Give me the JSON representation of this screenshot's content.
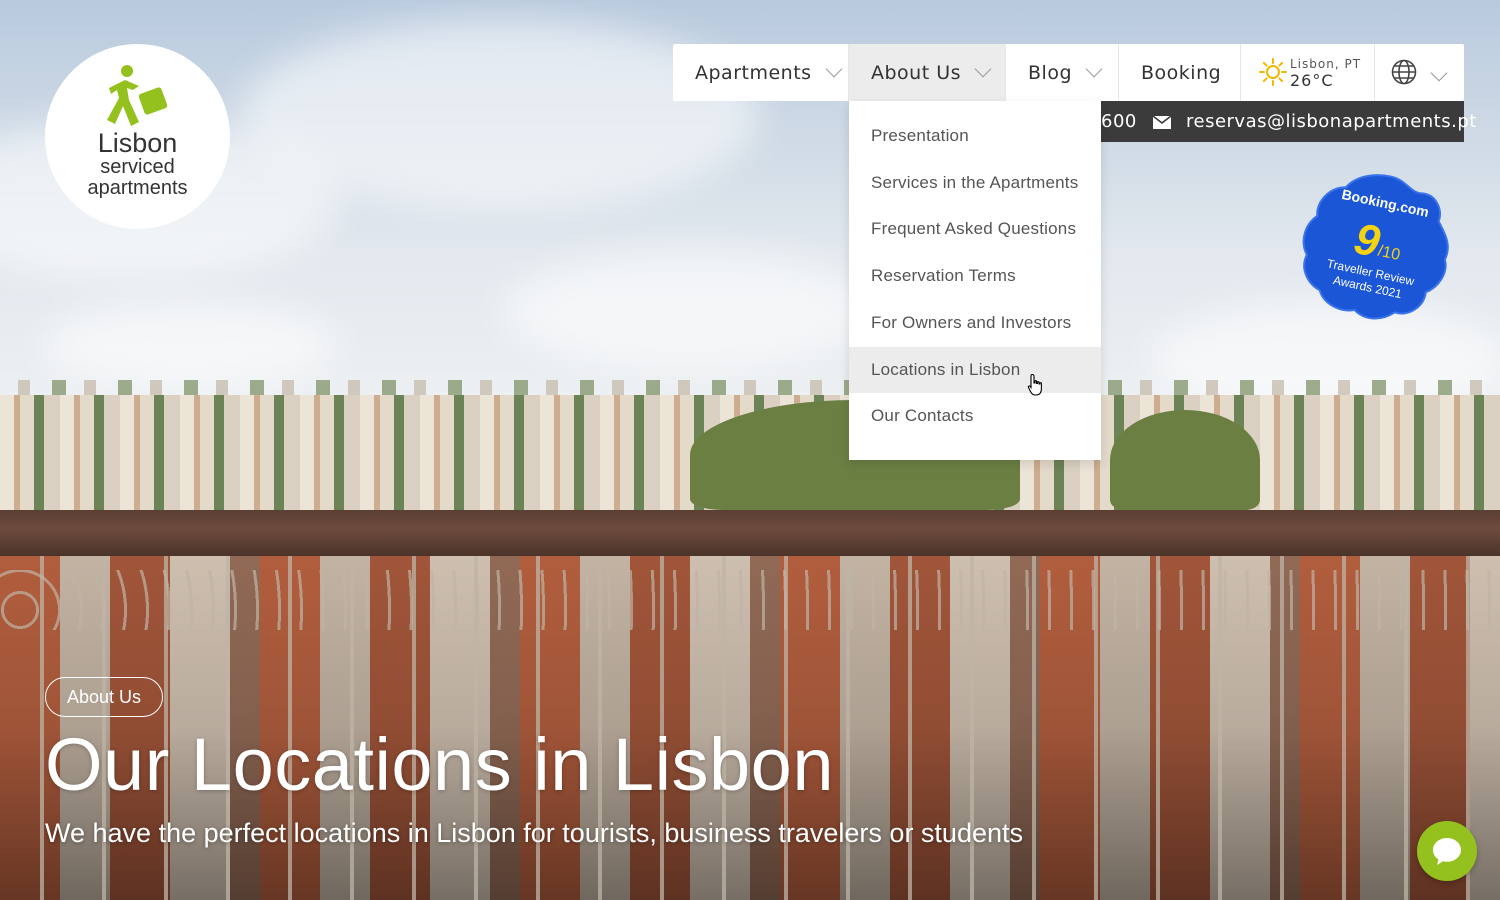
{
  "logo": {
    "line1": "Lisbon",
    "line2": "serviced",
    "line3": "apartments",
    "brand_color": "#95c11f"
  },
  "nav": {
    "items": [
      {
        "label": "Apartments",
        "has_dropdown": true
      },
      {
        "label": "About Us",
        "has_dropdown": true,
        "active": true
      },
      {
        "label": "Blog",
        "has_dropdown": true
      },
      {
        "label": "Booking",
        "has_dropdown": false
      }
    ],
    "weather": {
      "city": "Lisbon, PT",
      "temp": "26°C",
      "icon": "sun-icon"
    },
    "language": {
      "icon": "globe-icon"
    }
  },
  "contact": {
    "phone": "600",
    "email": "reservas@lisbonapartments.pt",
    "bar_color": "#3b3b3b"
  },
  "dropdown": {
    "items": [
      {
        "label": "Presentation"
      },
      {
        "label": "Services in the Apartments"
      },
      {
        "label": "Frequent Asked Questions"
      },
      {
        "label": "Reservation Terms"
      },
      {
        "label": "For Owners and Investors"
      },
      {
        "label": "Locations in Lisbon",
        "hovered": true
      },
      {
        "label": "Our Contacts"
      }
    ]
  },
  "badge": {
    "brand": "Booking.com",
    "score": "9",
    "scale": "/10",
    "line1": "Traveller Review",
    "line2": "Awards 2021",
    "color": "#1a56d6"
  },
  "hero": {
    "pill": "About Us",
    "title": "Our Locations in Lisbon",
    "subtitle": "We have the perfect locations in Lisbon for tourists, business travelers or students"
  },
  "chat": {
    "icon": "chat-bubble-icon",
    "color": "#95c11f"
  }
}
